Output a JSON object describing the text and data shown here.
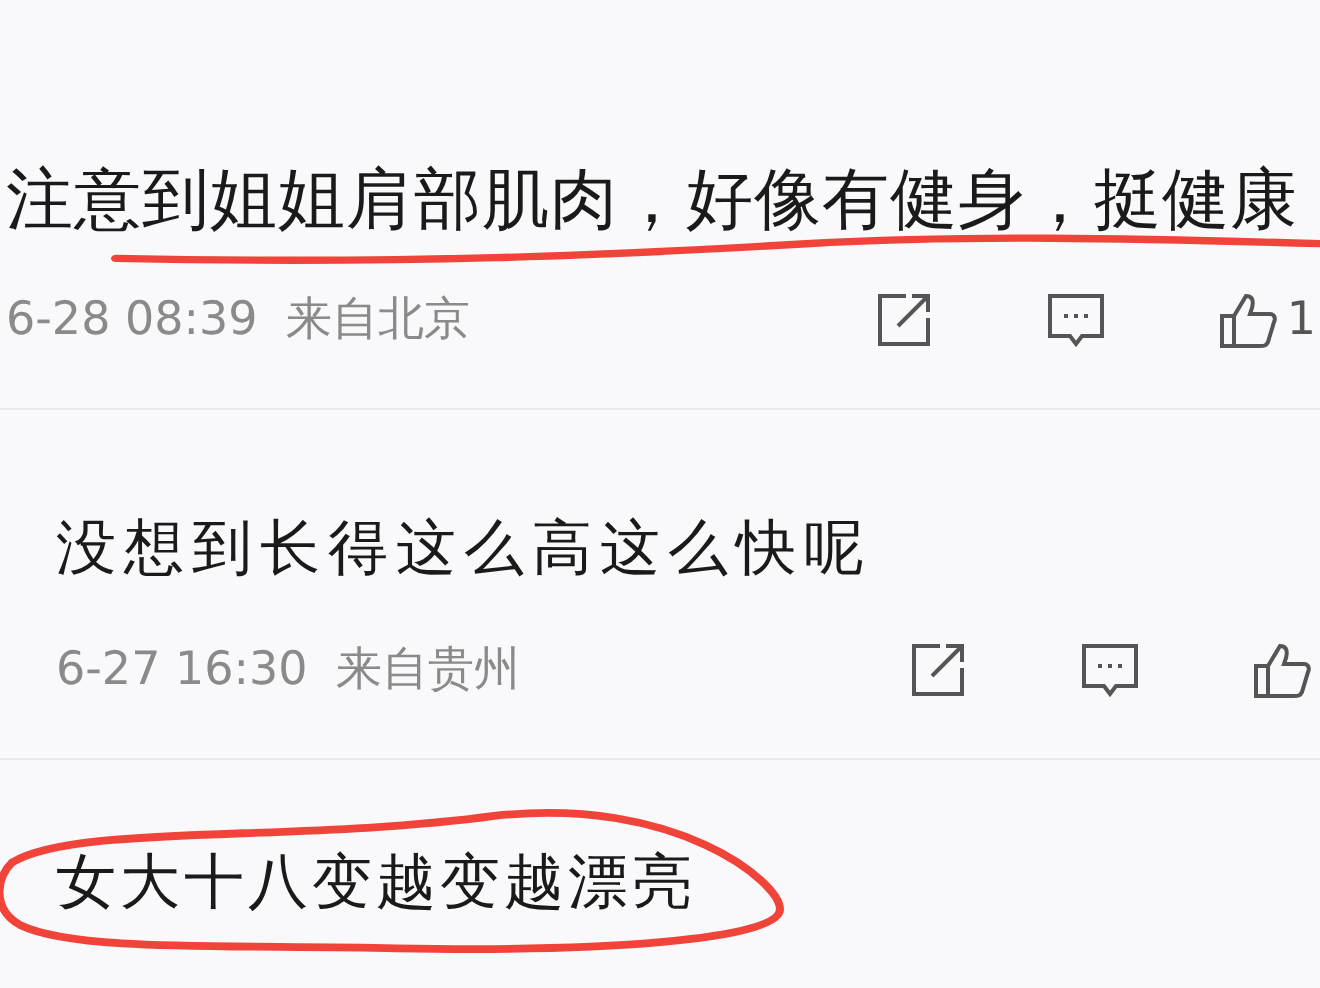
{
  "comments": [
    {
      "text": "注意到姐姐肩部肌肉，好像有健身，挺健康",
      "time": "6-28 08:39",
      "location": "来自北京",
      "likes": "1",
      "underlined": true,
      "circled": false
    },
    {
      "text": "没想到长得这么高这么快呢",
      "time": "6-27 16:30",
      "location": "来自贵州",
      "underlined": false,
      "circled": false
    },
    {
      "text": "女大十八变越变越漂亮",
      "underlined": false,
      "circled": true
    }
  ]
}
